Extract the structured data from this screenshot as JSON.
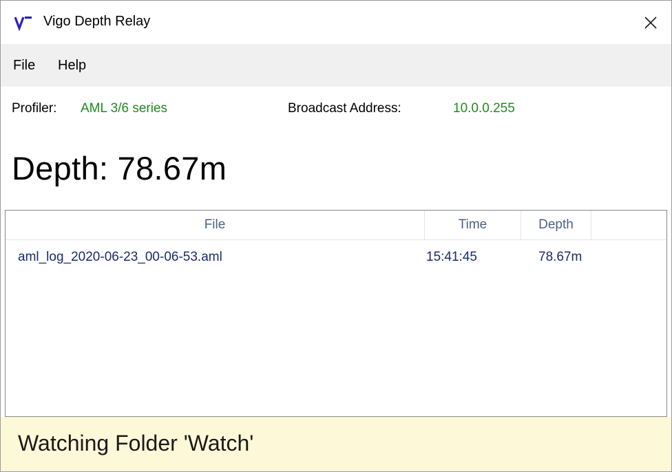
{
  "window": {
    "title": "Vigo Depth Relay",
    "app_icon": "vigo-logo-icon",
    "close_icon": "close-icon",
    "accent_color": "#2a1fb8"
  },
  "menu": {
    "items": [
      {
        "label": "File"
      },
      {
        "label": "Help"
      }
    ]
  },
  "info": {
    "profiler_label": "Profiler:",
    "profiler_value": "AML 3/6 series",
    "broadcast_label": "Broadcast Address:",
    "broadcast_value": "10.0.0.255",
    "value_color": "#1f8a1f"
  },
  "depth": {
    "text": "Depth: 78.67m"
  },
  "table": {
    "columns": [
      {
        "label": "File"
      },
      {
        "label": "Time"
      },
      {
        "label": "Depth"
      }
    ],
    "rows": [
      {
        "file": "aml_log_2020-06-23_00-06-53.aml",
        "time": "15:41:45",
        "depth": "78.67m"
      }
    ]
  },
  "status": {
    "text": "Watching Folder 'Watch'",
    "background": "#fdf8d7"
  }
}
